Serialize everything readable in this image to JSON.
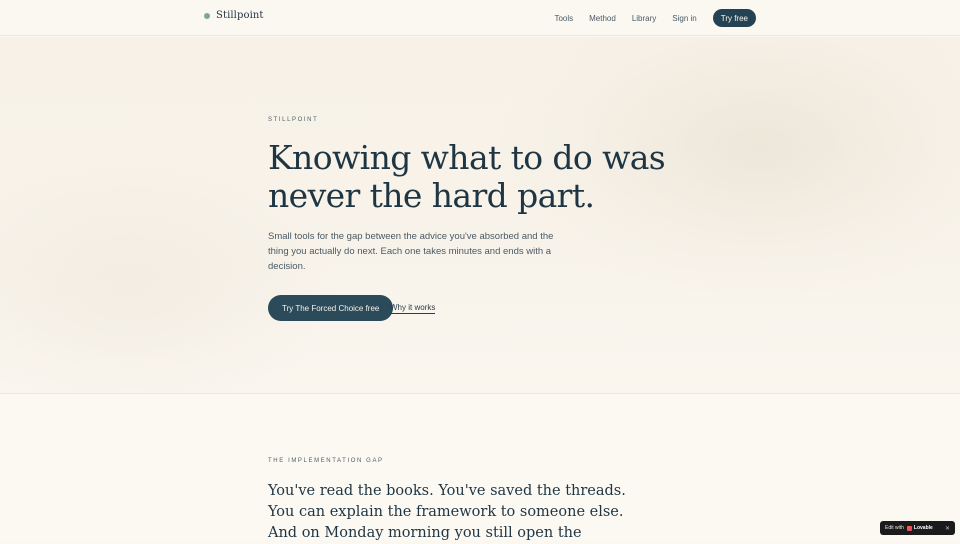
{
  "nav": {
    "brand": "Stillpoint",
    "links": [
      "Tools",
      "Method",
      "Library",
      "Sign in"
    ],
    "cta": "Try free"
  },
  "hero": {
    "eyebrow": "STILLPOINT",
    "title_line1": "Knowing what to do was",
    "title_line2": "never the hard part.",
    "subtitle": "Small tools for the gap between the advice you've absorbed and the thing you actually do next. Each one takes minutes and ends with a decision.",
    "cta": "Try The Forced Choice free",
    "secondary_link": "Why it works"
  },
  "section": {
    "eyebrow": "THE IMPLEMENTATION GAP",
    "quote_line1": "You've read the books. You've saved the threads.",
    "quote_line2": "You can explain the framework to someone else.",
    "quote_line3": "And on Monday morning you still open the"
  },
  "badge": {
    "prefix": "Edit with",
    "brand": "Lovable",
    "close": "✕"
  },
  "colors": {
    "primary": "#234354",
    "accent_dot": "#7fa593",
    "background": "#fbf7f1",
    "text": "#1e3644"
  }
}
